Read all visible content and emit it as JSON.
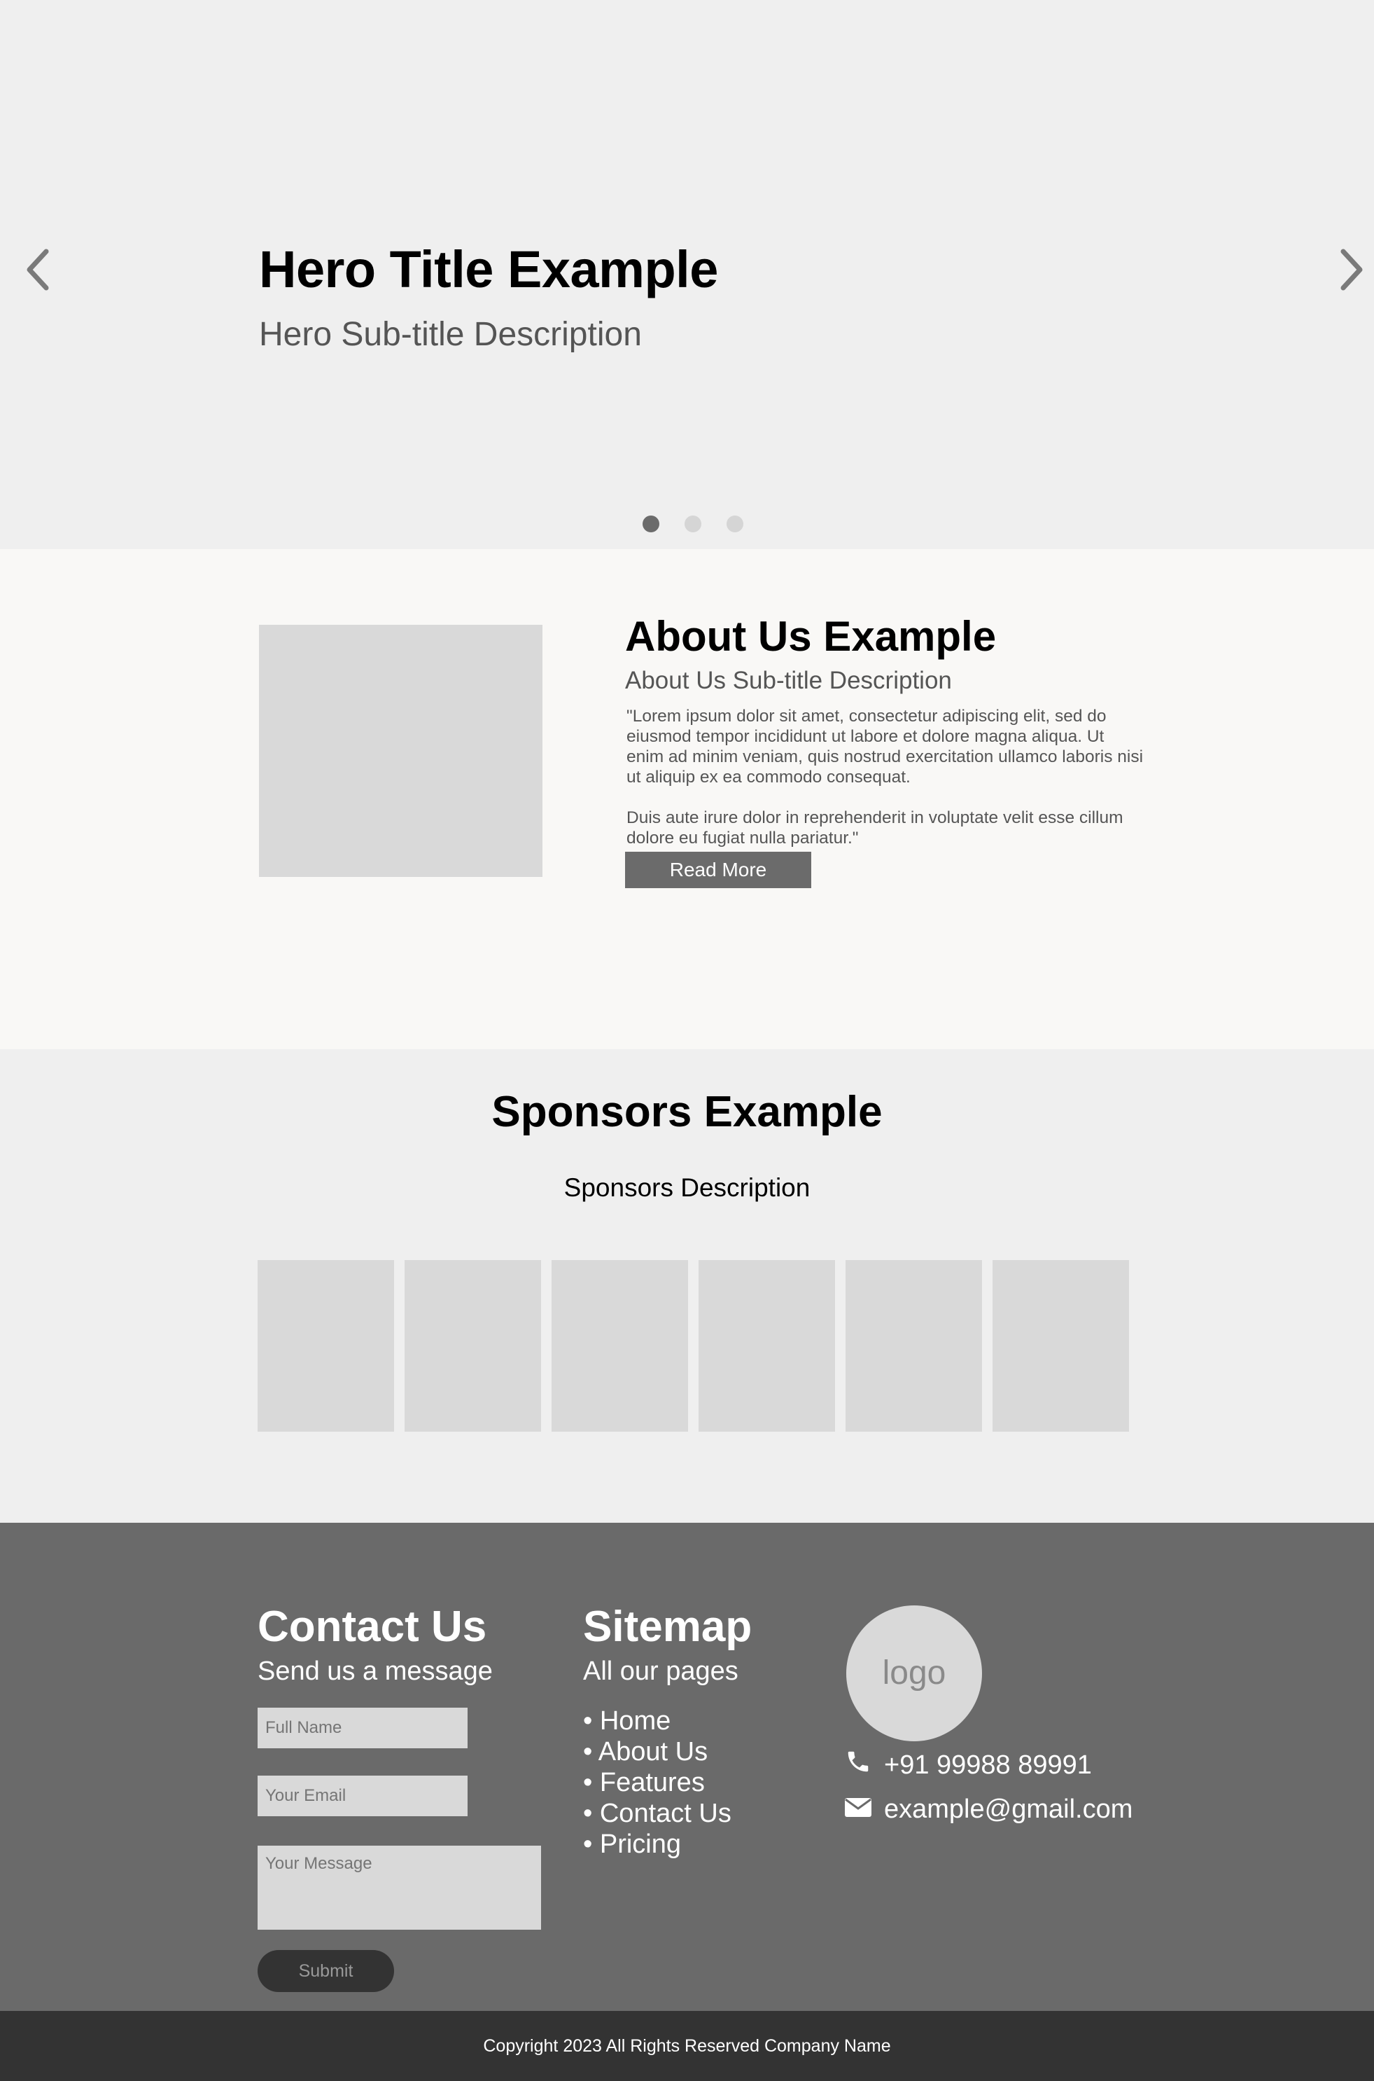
{
  "hero": {
    "title": "Hero Title Example",
    "subtitle": "Hero Sub-title Description",
    "slide_count": 3,
    "active_slide": 1
  },
  "about": {
    "title": "About Us Example",
    "subtitle": "About Us Sub-title Description",
    "paragraphs": [
      "\"Lorem ipsum dolor sit amet, consectetur adipiscing elit, sed do eiusmod tempor incididunt ut labore et dolore magna aliqua. Ut enim ad minim veniam, quis nostrud exercitation ullamco laboris nisi ut aliquip ex ea commodo consequat.",
      "Duis aute irure dolor in reprehenderit in voluptate velit esse cillum dolore eu fugiat nulla pariatur.\""
    ],
    "button_label": "Read More"
  },
  "sponsors": {
    "title": "Sponsors Example",
    "description": "Sponsors Description",
    "logo_count": 6
  },
  "footer": {
    "contact": {
      "title": "Contact Us",
      "subtitle": "Send us a message",
      "name_placeholder": "Full Name",
      "email_placeholder": "Your Email",
      "message_placeholder": "Your Message",
      "submit_label": "Submit"
    },
    "sitemap": {
      "title": "Sitemap",
      "subtitle": "All our pages",
      "items": [
        "• Home",
        "• About Us",
        "• Features",
        "• Contact Us",
        "• Pricing"
      ]
    },
    "brand": {
      "logo_text": "logo",
      "phone": "+91 99988 89991",
      "email": "example@gmail.com",
      "phone_icon": "phone-icon",
      "email_icon": "envelope-icon"
    },
    "copyright": "Copyright 2023 All Rights Reserved Company Name"
  },
  "colors": {
    "hero_bg": "#efefef",
    "about_bg": "#f9f8f6",
    "footer_bg": "#6a6a6a",
    "copyright_bg": "#333333",
    "button_bg": "#6b6b6b",
    "placeholder_box": "#d9d9d9"
  }
}
